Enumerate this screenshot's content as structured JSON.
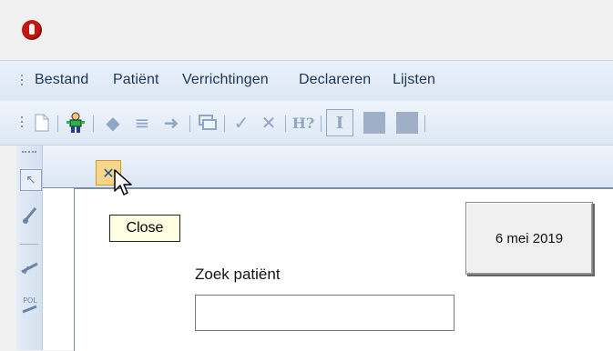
{
  "menu": {
    "items": [
      "Bestand",
      "Patiënt",
      "Verrichtingen",
      "Declareren",
      "Lijsten"
    ]
  },
  "toolbar": {
    "icons": [
      "new-document-icon",
      "patient-icon",
      "back-arrow-icon",
      "list-icon",
      "forward-arrow-icon",
      "windows-icon",
      "check-icon",
      "cross-icon",
      "help-icon",
      "text-cursor-icon",
      "square-icon",
      "square-icon"
    ],
    "help_label": "H?"
  },
  "left_toolbar": {
    "icons": [
      "pointer-icon",
      "pen-icon",
      "tooth-tool-icon",
      "pol-tool-icon"
    ],
    "pol_label": "POL"
  },
  "tooltip": {
    "text": "Close"
  },
  "date_button": {
    "label": "6 mei 2019"
  },
  "search": {
    "label": "Zoek patiënt",
    "value": ""
  },
  "colors": {
    "accent": "#c0180e",
    "menu_text": "#1e3556",
    "tooltip_bg": "#ffffe1",
    "tab_highlight": "#f6d68a"
  }
}
